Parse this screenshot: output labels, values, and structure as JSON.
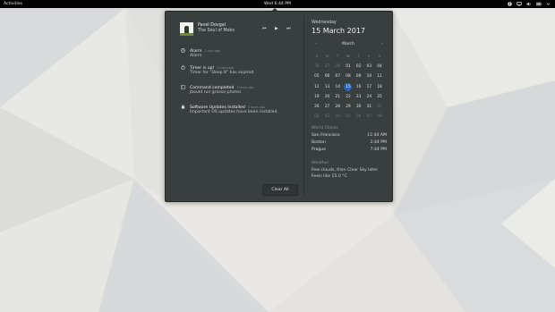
{
  "topbar": {
    "activities": "Activities",
    "clock": "Wed  6:44 PM"
  },
  "tray_icons": [
    "accessibility-icon",
    "network-icon",
    "volume-icon",
    "battery-icon",
    "chevron-down-icon"
  ],
  "player": {
    "artist": "Pavel Dovgal",
    "album": "The Soul of Moks",
    "controls": {
      "prev": "⏮",
      "play": "▶",
      "next": "⏭"
    }
  },
  "notifications": [
    {
      "icon": "alarm-icon",
      "title": "Alarm",
      "time": "1 hour ago",
      "body": "Alarm"
    },
    {
      "icon": "timer-icon",
      "title": "Timer is up!",
      "time": "2 hours ago",
      "body": "Timer for \"Deep 8\" has expired."
    },
    {
      "icon": "terminal-icon",
      "title": "Command completed",
      "time": "2 hours ago",
      "body": "jbould run grasso-photos"
    },
    {
      "icon": "software-update-icon",
      "title": "Software Updates Installed",
      "time": "3 hours ago",
      "body": "Important OS updates have been installed."
    }
  ],
  "clear_all": "Clear All",
  "calendar": {
    "weekday": "Wednesday",
    "full_date": "15 March 2017",
    "month": "March",
    "prev_arrow": "‹",
    "next_arrow": "›",
    "weekday_headers": [
      "S",
      "M",
      "T",
      "W",
      "T",
      "F",
      "S"
    ],
    "weeks": [
      [
        {
          "d": "26",
          "dim": true
        },
        {
          "d": "27",
          "dim": true
        },
        {
          "d": "28",
          "dim": true
        },
        {
          "d": "01"
        },
        {
          "d": "02"
        },
        {
          "d": "03"
        },
        {
          "d": "04"
        }
      ],
      [
        {
          "d": "05"
        },
        {
          "d": "06"
        },
        {
          "d": "07"
        },
        {
          "d": "08"
        },
        {
          "d": "09"
        },
        {
          "d": "10"
        },
        {
          "d": "11"
        }
      ],
      [
        {
          "d": "12"
        },
        {
          "d": "13"
        },
        {
          "d": "14"
        },
        {
          "d": "15",
          "today": true
        },
        {
          "d": "16"
        },
        {
          "d": "17"
        },
        {
          "d": "18"
        }
      ],
      [
        {
          "d": "19"
        },
        {
          "d": "20"
        },
        {
          "d": "21"
        },
        {
          "d": "22"
        },
        {
          "d": "23"
        },
        {
          "d": "24"
        },
        {
          "d": "25"
        }
      ],
      [
        {
          "d": "26"
        },
        {
          "d": "27"
        },
        {
          "d": "28"
        },
        {
          "d": "29"
        },
        {
          "d": "30"
        },
        {
          "d": "31"
        },
        {
          "d": "01",
          "dim": true
        }
      ],
      [
        {
          "d": "02",
          "dim": true
        },
        {
          "d": "03",
          "dim": true
        },
        {
          "d": "04",
          "dim": true
        },
        {
          "d": "05",
          "dim": true
        },
        {
          "d": "06",
          "dim": true
        },
        {
          "d": "07",
          "dim": true
        },
        {
          "d": "08",
          "dim": true
        }
      ]
    ]
  },
  "world_clocks": {
    "title": "World Clocks",
    "rows": [
      {
        "city": "San Francisco",
        "time": "11:44 AM"
      },
      {
        "city": "Boston",
        "time": "2:44 PM"
      },
      {
        "city": "Prague",
        "time": "7:44 PM"
      }
    ]
  },
  "weather": {
    "title": "Weather",
    "line1": "Few clouds, then Clear Sky later.",
    "line2": "Feels like 15.0 °C"
  },
  "colors": {
    "popup_bg": "#393f3f",
    "today_accent": "#2c66b5",
    "topbar_bg": "#000000"
  }
}
